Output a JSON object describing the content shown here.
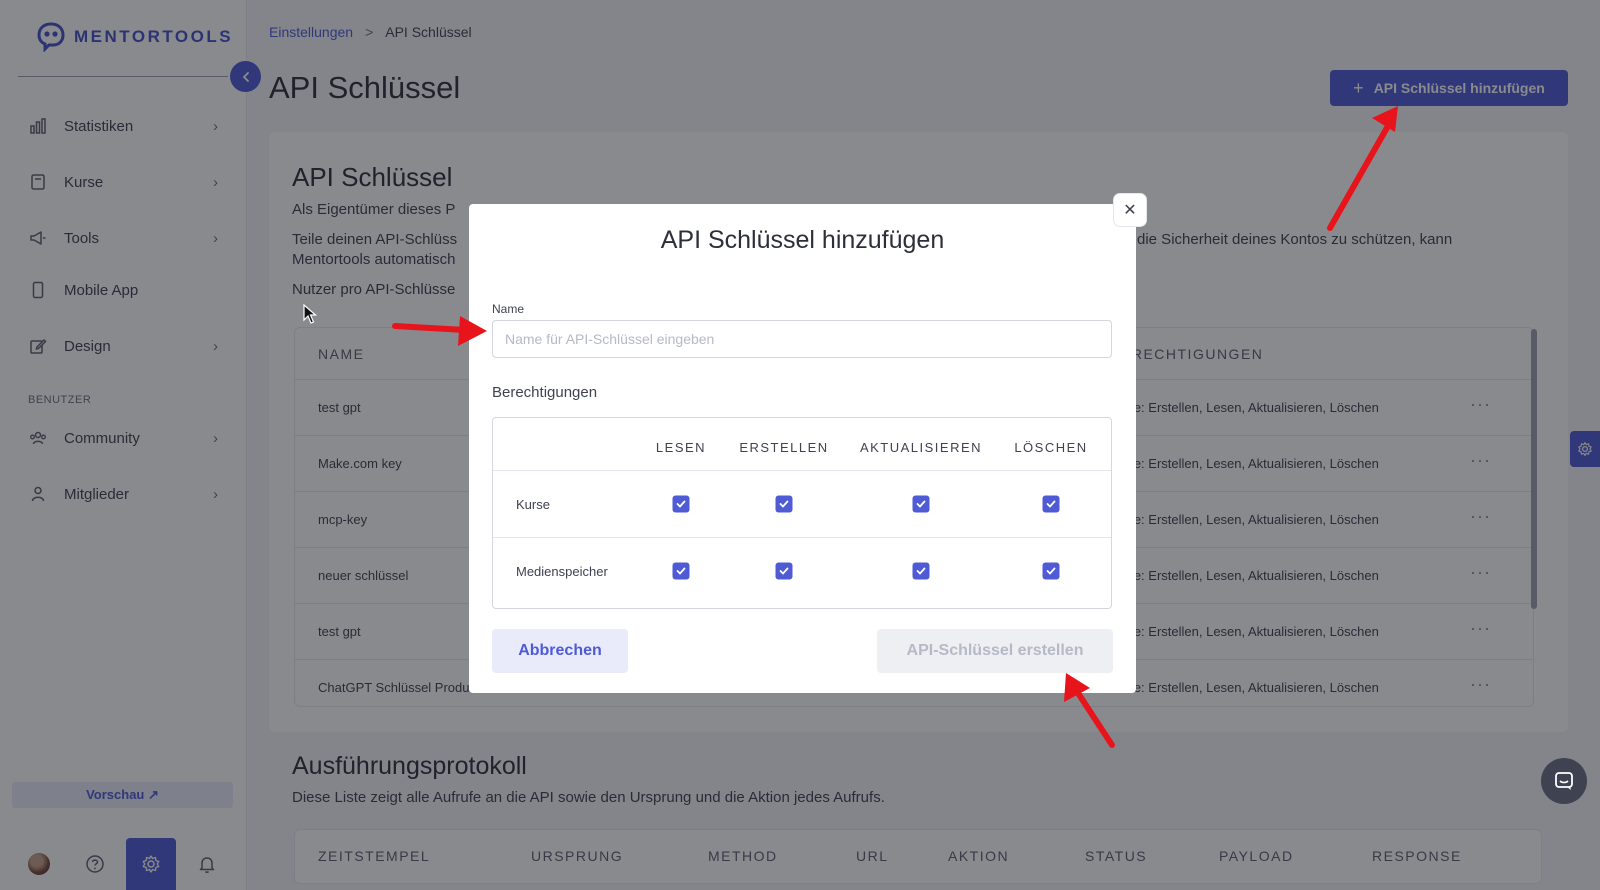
{
  "brand": {
    "name": "MENTORTOOLS"
  },
  "sidebar": {
    "items": [
      {
        "label": "Statistiken",
        "icon": "bar-chart-icon",
        "has_chevron": true
      },
      {
        "label": "Kurse",
        "icon": "book-icon",
        "has_chevron": true
      },
      {
        "label": "Tools",
        "icon": "megaphone-icon",
        "has_chevron": true
      },
      {
        "label": "Mobile App",
        "icon": "smartphone-icon",
        "has_chevron": false
      },
      {
        "label": "Design",
        "icon": "edit-icon",
        "has_chevron": true
      },
      {
        "label": "Community",
        "icon": "users-icon",
        "has_chevron": true
      },
      {
        "label": "Mitglieder",
        "icon": "user-icon",
        "has_chevron": true
      }
    ],
    "section_label": "BENUTZER",
    "preview_label": "Vorschau ↗",
    "bottom_icons": [
      "avatar",
      "help-icon",
      "gear-icon",
      "bell-icon"
    ]
  },
  "breadcrumb": {
    "parent": "Einstellungen",
    "separator": ">",
    "current": "API Schlüssel"
  },
  "page": {
    "title": "API Schlüssel",
    "add_button": "API Schlüssel hinzufügen"
  },
  "card": {
    "title": "API Schlüssel",
    "p1": "Als Eigentümer dieses P",
    "p2a": "Teile deinen API-Schlüss",
    "p2b": "die Sicherheit deines Kontos zu schützen, kann",
    "p2c": "Mentortools automatisch",
    "p3": "Nutzer pro API-Schlüsse",
    "table": {
      "headers": [
        "NAME",
        "ERECHTIGUNGEN"
      ],
      "rows": [
        {
          "name": "test gpt",
          "permissions": "rse: Erstellen, Lesen, Aktualisieren, Löschen"
        },
        {
          "name": "Make.com key",
          "permissions": "rse: Erstellen, Lesen, Aktualisieren, Löschen"
        },
        {
          "name": "mcp-key",
          "permissions": "rse: Erstellen, Lesen, Aktualisieren, Löschen"
        },
        {
          "name": "neuer schlüssel",
          "permissions": "rse: Erstellen, Lesen, Aktualisieren, Löschen"
        },
        {
          "name": "test gpt",
          "permissions": "rse: Erstellen, Lesen, Aktualisieren, Löschen"
        },
        {
          "name": "ChatGPT Schlüssel Produ",
          "permissions": "rse: Erstellen, Lesen, Aktualisieren, Löschen"
        }
      ],
      "row_menu": "···"
    }
  },
  "log": {
    "title": "Ausführungsprotokoll",
    "description": "Diese Liste zeigt alle Aufrufe an die API sowie den Ursprung und die Aktion jedes Aufrufs.",
    "headers": [
      "ZEITSTEMPEL",
      "URSPRUNG",
      "METHOD",
      "URL",
      "AKTION",
      "STATUS",
      "PAYLOAD",
      "RESPONSE"
    ]
  },
  "modal": {
    "title": "API Schlüssel hinzufügen",
    "close": "✕",
    "name_label": "Name",
    "name_value": "",
    "name_placeholder": "Name für API-Schlüssel eingeben",
    "permissions_label": "Berechtigungen",
    "permission_columns": [
      "LESEN",
      "ERSTELLEN",
      "AKTUALISIEREN",
      "LÖSCHEN"
    ],
    "permission_rows": [
      {
        "label": "Kurse",
        "checked": [
          true,
          true,
          true,
          true
        ]
      },
      {
        "label": "Medienspeicher",
        "checked": [
          true,
          true,
          true,
          true
        ]
      }
    ],
    "cancel_label": "Abbrechen",
    "create_label": "API-Schlüssel erstellen"
  },
  "colors": {
    "accent": "#4f5bd5",
    "accent_light": "#e9ebfb",
    "arrow": "#e8141c",
    "text": "#2d2f3a",
    "disabled_text": "#b6b9c6"
  }
}
